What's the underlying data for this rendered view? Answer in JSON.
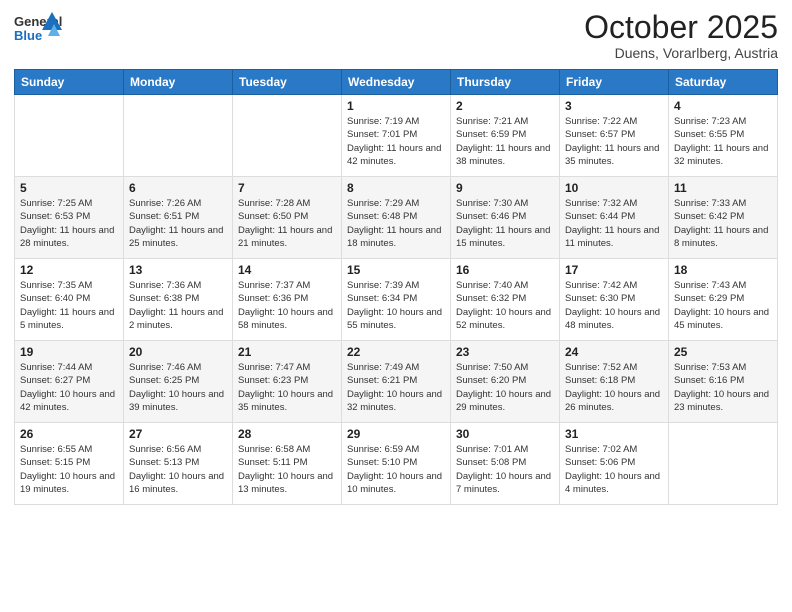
{
  "header": {
    "logo_general": "General",
    "logo_blue": "Blue",
    "month_title": "October 2025",
    "subtitle": "Duens, Vorarlberg, Austria"
  },
  "weekdays": [
    "Sunday",
    "Monday",
    "Tuesday",
    "Wednesday",
    "Thursday",
    "Friday",
    "Saturday"
  ],
  "weeks": [
    [
      {
        "day": "",
        "sunrise": "",
        "sunset": "",
        "daylight": ""
      },
      {
        "day": "",
        "sunrise": "",
        "sunset": "",
        "daylight": ""
      },
      {
        "day": "",
        "sunrise": "",
        "sunset": "",
        "daylight": ""
      },
      {
        "day": "1",
        "sunrise": "Sunrise: 7:19 AM",
        "sunset": "Sunset: 7:01 PM",
        "daylight": "Daylight: 11 hours and 42 minutes."
      },
      {
        "day": "2",
        "sunrise": "Sunrise: 7:21 AM",
        "sunset": "Sunset: 6:59 PM",
        "daylight": "Daylight: 11 hours and 38 minutes."
      },
      {
        "day": "3",
        "sunrise": "Sunrise: 7:22 AM",
        "sunset": "Sunset: 6:57 PM",
        "daylight": "Daylight: 11 hours and 35 minutes."
      },
      {
        "day": "4",
        "sunrise": "Sunrise: 7:23 AM",
        "sunset": "Sunset: 6:55 PM",
        "daylight": "Daylight: 11 hours and 32 minutes."
      }
    ],
    [
      {
        "day": "5",
        "sunrise": "Sunrise: 7:25 AM",
        "sunset": "Sunset: 6:53 PM",
        "daylight": "Daylight: 11 hours and 28 minutes."
      },
      {
        "day": "6",
        "sunrise": "Sunrise: 7:26 AM",
        "sunset": "Sunset: 6:51 PM",
        "daylight": "Daylight: 11 hours and 25 minutes."
      },
      {
        "day": "7",
        "sunrise": "Sunrise: 7:28 AM",
        "sunset": "Sunset: 6:50 PM",
        "daylight": "Daylight: 11 hours and 21 minutes."
      },
      {
        "day": "8",
        "sunrise": "Sunrise: 7:29 AM",
        "sunset": "Sunset: 6:48 PM",
        "daylight": "Daylight: 11 hours and 18 minutes."
      },
      {
        "day": "9",
        "sunrise": "Sunrise: 7:30 AM",
        "sunset": "Sunset: 6:46 PM",
        "daylight": "Daylight: 11 hours and 15 minutes."
      },
      {
        "day": "10",
        "sunrise": "Sunrise: 7:32 AM",
        "sunset": "Sunset: 6:44 PM",
        "daylight": "Daylight: 11 hours and 11 minutes."
      },
      {
        "day": "11",
        "sunrise": "Sunrise: 7:33 AM",
        "sunset": "Sunset: 6:42 PM",
        "daylight": "Daylight: 11 hours and 8 minutes."
      }
    ],
    [
      {
        "day": "12",
        "sunrise": "Sunrise: 7:35 AM",
        "sunset": "Sunset: 6:40 PM",
        "daylight": "Daylight: 11 hours and 5 minutes."
      },
      {
        "day": "13",
        "sunrise": "Sunrise: 7:36 AM",
        "sunset": "Sunset: 6:38 PM",
        "daylight": "Daylight: 11 hours and 2 minutes."
      },
      {
        "day": "14",
        "sunrise": "Sunrise: 7:37 AM",
        "sunset": "Sunset: 6:36 PM",
        "daylight": "Daylight: 10 hours and 58 minutes."
      },
      {
        "day": "15",
        "sunrise": "Sunrise: 7:39 AM",
        "sunset": "Sunset: 6:34 PM",
        "daylight": "Daylight: 10 hours and 55 minutes."
      },
      {
        "day": "16",
        "sunrise": "Sunrise: 7:40 AM",
        "sunset": "Sunset: 6:32 PM",
        "daylight": "Daylight: 10 hours and 52 minutes."
      },
      {
        "day": "17",
        "sunrise": "Sunrise: 7:42 AM",
        "sunset": "Sunset: 6:30 PM",
        "daylight": "Daylight: 10 hours and 48 minutes."
      },
      {
        "day": "18",
        "sunrise": "Sunrise: 7:43 AM",
        "sunset": "Sunset: 6:29 PM",
        "daylight": "Daylight: 10 hours and 45 minutes."
      }
    ],
    [
      {
        "day": "19",
        "sunrise": "Sunrise: 7:44 AM",
        "sunset": "Sunset: 6:27 PM",
        "daylight": "Daylight: 10 hours and 42 minutes."
      },
      {
        "day": "20",
        "sunrise": "Sunrise: 7:46 AM",
        "sunset": "Sunset: 6:25 PM",
        "daylight": "Daylight: 10 hours and 39 minutes."
      },
      {
        "day": "21",
        "sunrise": "Sunrise: 7:47 AM",
        "sunset": "Sunset: 6:23 PM",
        "daylight": "Daylight: 10 hours and 35 minutes."
      },
      {
        "day": "22",
        "sunrise": "Sunrise: 7:49 AM",
        "sunset": "Sunset: 6:21 PM",
        "daylight": "Daylight: 10 hours and 32 minutes."
      },
      {
        "day": "23",
        "sunrise": "Sunrise: 7:50 AM",
        "sunset": "Sunset: 6:20 PM",
        "daylight": "Daylight: 10 hours and 29 minutes."
      },
      {
        "day": "24",
        "sunrise": "Sunrise: 7:52 AM",
        "sunset": "Sunset: 6:18 PM",
        "daylight": "Daylight: 10 hours and 26 minutes."
      },
      {
        "day": "25",
        "sunrise": "Sunrise: 7:53 AM",
        "sunset": "Sunset: 6:16 PM",
        "daylight": "Daylight: 10 hours and 23 minutes."
      }
    ],
    [
      {
        "day": "26",
        "sunrise": "Sunrise: 6:55 AM",
        "sunset": "Sunset: 5:15 PM",
        "daylight": "Daylight: 10 hours and 19 minutes."
      },
      {
        "day": "27",
        "sunrise": "Sunrise: 6:56 AM",
        "sunset": "Sunset: 5:13 PM",
        "daylight": "Daylight: 10 hours and 16 minutes."
      },
      {
        "day": "28",
        "sunrise": "Sunrise: 6:58 AM",
        "sunset": "Sunset: 5:11 PM",
        "daylight": "Daylight: 10 hours and 13 minutes."
      },
      {
        "day": "29",
        "sunrise": "Sunrise: 6:59 AM",
        "sunset": "Sunset: 5:10 PM",
        "daylight": "Daylight: 10 hours and 10 minutes."
      },
      {
        "day": "30",
        "sunrise": "Sunrise: 7:01 AM",
        "sunset": "Sunset: 5:08 PM",
        "daylight": "Daylight: 10 hours and 7 minutes."
      },
      {
        "day": "31",
        "sunrise": "Sunrise: 7:02 AM",
        "sunset": "Sunset: 5:06 PM",
        "daylight": "Daylight: 10 hours and 4 minutes."
      },
      {
        "day": "",
        "sunrise": "",
        "sunset": "",
        "daylight": ""
      }
    ]
  ]
}
